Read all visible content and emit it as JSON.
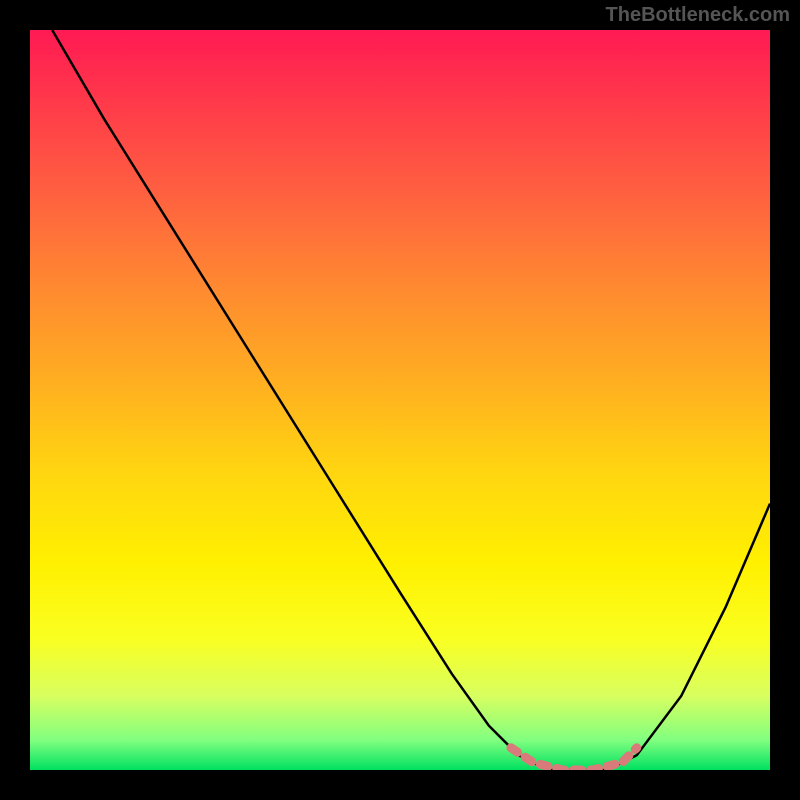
{
  "watermark": "TheBottleneck.com",
  "chart_data": {
    "type": "line",
    "title": "",
    "xlabel": "",
    "ylabel": "",
    "xlim": [
      0,
      100
    ],
    "ylim": [
      0,
      100
    ],
    "series": [
      {
        "name": "bottleneck-curve",
        "x": [
          3,
          10,
          20,
          30,
          40,
          50,
          57,
          62,
          66,
          70,
          74,
          78,
          82,
          88,
          94,
          100
        ],
        "y": [
          100,
          88,
          72,
          56,
          40,
          24,
          13,
          6,
          2,
          0,
          0,
          0,
          2,
          10,
          22,
          36
        ]
      },
      {
        "name": "optimal-zone",
        "x": [
          65,
          68,
          72,
          76,
          80,
          82
        ],
        "y": [
          3,
          1,
          0,
          0,
          1,
          3
        ]
      }
    ],
    "colors": {
      "curve": "#000000",
      "zone": "#d97b7b"
    }
  }
}
